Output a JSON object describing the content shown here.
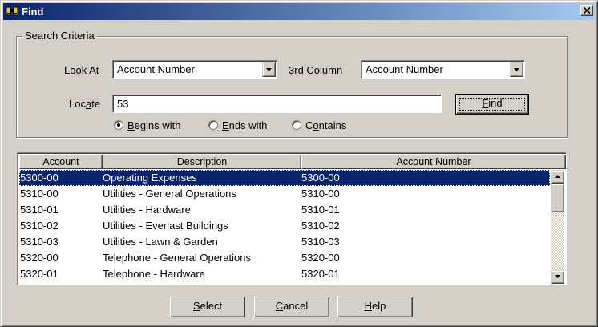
{
  "window": {
    "title": "Find",
    "title_icon": "binoculars-icon",
    "close_icon": "close-icon"
  },
  "search_criteria": {
    "legend": "Search Criteria",
    "look_at": {
      "label_pre": "",
      "label_key": "L",
      "label_post": "ook At",
      "value": "Account Number"
    },
    "third_column": {
      "label_pre": "",
      "label_key": "3",
      "label_post": "rd Column",
      "value": "Account Number"
    },
    "locate": {
      "label_pre": "Loc",
      "label_key": "a",
      "label_post": "te",
      "value": "53"
    },
    "find_button": {
      "label_pre": "",
      "label_key": "F",
      "label_post": "ind"
    },
    "match_options": [
      {
        "label_pre": "",
        "label_key": "B",
        "label_post": "egins with",
        "selected": true
      },
      {
        "label_pre": "",
        "label_key": "E",
        "label_post": "nds with",
        "selected": false
      },
      {
        "label_pre": "C",
        "label_key": "o",
        "label_post": "ntains",
        "selected": false
      }
    ]
  },
  "results": {
    "columns": [
      "Account",
      "Description",
      "Account Number"
    ],
    "rows": [
      {
        "account": "5300-00",
        "description": "Operating Expenses",
        "account_number": "5300-00",
        "selected": true
      },
      {
        "account": "5310-00",
        "description": "Utilities - General Operations",
        "account_number": "5310-00",
        "selected": false
      },
      {
        "account": "5310-01",
        "description": "Utilities - Hardware",
        "account_number": "5310-01",
        "selected": false
      },
      {
        "account": "5310-02",
        "description": "Utilities - Everlast Buildings",
        "account_number": "5310-02",
        "selected": false
      },
      {
        "account": "5310-03",
        "description": "Utilities - Lawn & Garden",
        "account_number": "5310-03",
        "selected": false
      },
      {
        "account": "5320-00",
        "description": "Telephone - General Operations",
        "account_number": "5320-00",
        "selected": false
      },
      {
        "account": "5320-01",
        "description": "Telephone - Hardware",
        "account_number": "5320-01",
        "selected": false
      }
    ]
  },
  "buttons": {
    "select": {
      "label_pre": "",
      "label_key": "S",
      "label_post": "elect"
    },
    "cancel": {
      "label_pre": "",
      "label_key": "C",
      "label_post": "ancel"
    },
    "help": {
      "label_pre": "",
      "label_key": "H",
      "label_post": "elp"
    }
  },
  "colors": {
    "dialog_face": "#d4d0c8",
    "title_gradient_start": "#0a246a",
    "title_gradient_end": "#a6caf0",
    "selection": "#0a246a"
  }
}
